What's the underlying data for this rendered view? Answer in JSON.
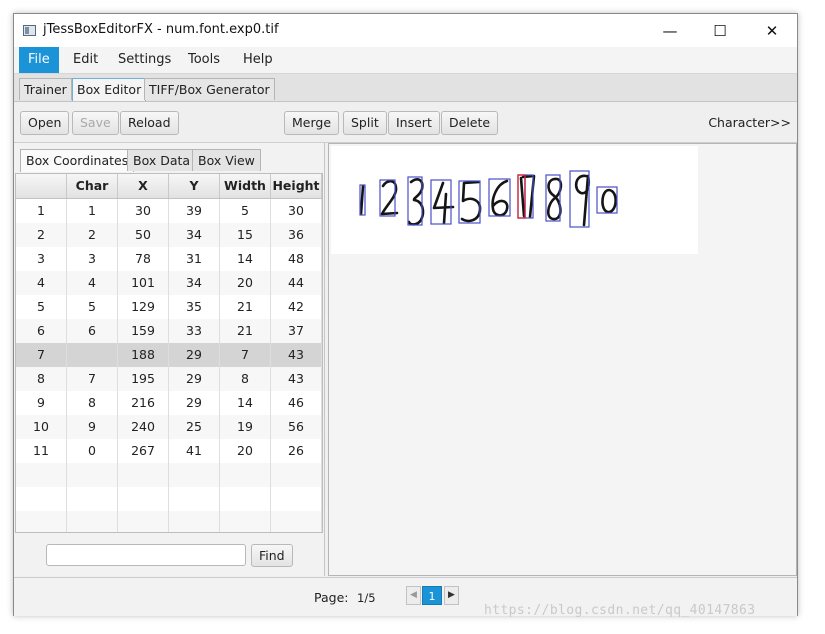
{
  "window": {
    "title": "jTessBoxEditorFX - num.font.exp0.tif"
  },
  "window_controls": {
    "minimize": "—",
    "maximize": "☐",
    "close": "✕"
  },
  "menu": [
    "File",
    "Edit",
    "Settings",
    "Tools",
    "Help"
  ],
  "tabs": [
    "Trainer",
    "Box Editor",
    "TIFF/Box Generator"
  ],
  "toolbar": {
    "open": "Open",
    "save": "Save",
    "reload": "Reload",
    "merge": "Merge",
    "split": "Split",
    "insert": "Insert",
    "delete": "Delete",
    "character": "Character>>"
  },
  "subtabs": [
    "Box Coordinates",
    "Box Data",
    "Box View"
  ],
  "table": {
    "headers": [
      "",
      "Char",
      "X",
      "Y",
      "Width",
      "Height"
    ],
    "rows": [
      [
        "1",
        "1",
        "30",
        "39",
        "5",
        "30"
      ],
      [
        "2",
        "2",
        "50",
        "34",
        "15",
        "36"
      ],
      [
        "3",
        "3",
        "78",
        "31",
        "14",
        "48"
      ],
      [
        "4",
        "4",
        "101",
        "34",
        "20",
        "44"
      ],
      [
        "5",
        "5",
        "129",
        "35",
        "21",
        "42"
      ],
      [
        "6",
        "6",
        "159",
        "33",
        "21",
        "37"
      ],
      [
        "7",
        "",
        "188",
        "29",
        "7",
        "43"
      ],
      [
        "8",
        "7",
        "195",
        "29",
        "8",
        "43"
      ],
      [
        "9",
        "8",
        "216",
        "29",
        "14",
        "46"
      ],
      [
        "10",
        "9",
        "240",
        "25",
        "19",
        "56"
      ],
      [
        "11",
        "0",
        "267",
        "41",
        "20",
        "26"
      ]
    ],
    "selected_row": 7
  },
  "find": {
    "button": "Find",
    "value": ""
  },
  "status": {
    "page_label": "Page:",
    "page_value": "1/5",
    "current_page": "1",
    "prev": "◀",
    "next": "▶"
  },
  "watermark": "https://blog.csdn.net/qq_40147863",
  "colors": {
    "accent": "#1a93d7",
    "box_outline": "#4a4fc9",
    "selected_box": "#c41f3a"
  }
}
